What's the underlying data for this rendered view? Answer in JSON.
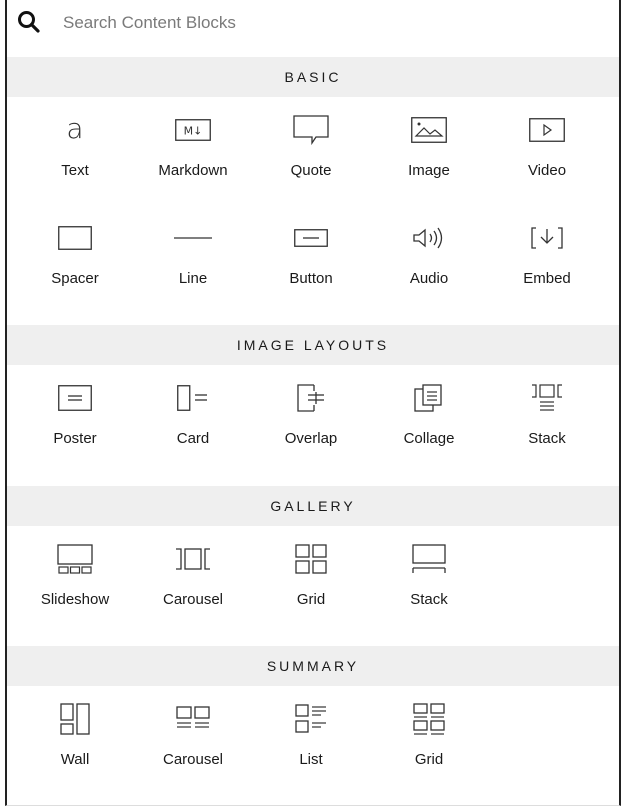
{
  "search": {
    "placeholder": "Search Content Blocks",
    "icon": "search-icon"
  },
  "sections": [
    {
      "title": "BASIC",
      "blocks": [
        {
          "label": "Text",
          "icon": "text-icon"
        },
        {
          "label": "Markdown",
          "icon": "markdown-icon"
        },
        {
          "label": "Quote",
          "icon": "quote-icon"
        },
        {
          "label": "Image",
          "icon": "image-icon"
        },
        {
          "label": "Video",
          "icon": "video-icon"
        },
        {
          "label": "Spacer",
          "icon": "spacer-icon"
        },
        {
          "label": "Line",
          "icon": "line-icon"
        },
        {
          "label": "Button",
          "icon": "button-icon"
        },
        {
          "label": "Audio",
          "icon": "audio-icon"
        },
        {
          "label": "Embed",
          "icon": "embed-icon"
        }
      ]
    },
    {
      "title": "IMAGE LAYOUTS",
      "blocks": [
        {
          "label": "Poster",
          "icon": "poster-icon"
        },
        {
          "label": "Card",
          "icon": "card-icon"
        },
        {
          "label": "Overlap",
          "icon": "overlap-icon"
        },
        {
          "label": "Collage",
          "icon": "collage-icon"
        },
        {
          "label": "Stack",
          "icon": "stack-icon"
        }
      ]
    },
    {
      "title": "GALLERY",
      "blocks": [
        {
          "label": "Slideshow",
          "icon": "slideshow-icon"
        },
        {
          "label": "Carousel",
          "icon": "carousel-icon"
        },
        {
          "label": "Grid",
          "icon": "grid-icon"
        },
        {
          "label": "Stack",
          "icon": "gallery-stack-icon"
        }
      ]
    },
    {
      "title": "SUMMARY",
      "blocks": [
        {
          "label": "Wall",
          "icon": "wall-icon"
        },
        {
          "label": "Carousel",
          "icon": "summary-carousel-icon"
        },
        {
          "label": "List",
          "icon": "list-icon"
        },
        {
          "label": "Grid",
          "icon": "summary-grid-icon"
        }
      ]
    }
  ]
}
